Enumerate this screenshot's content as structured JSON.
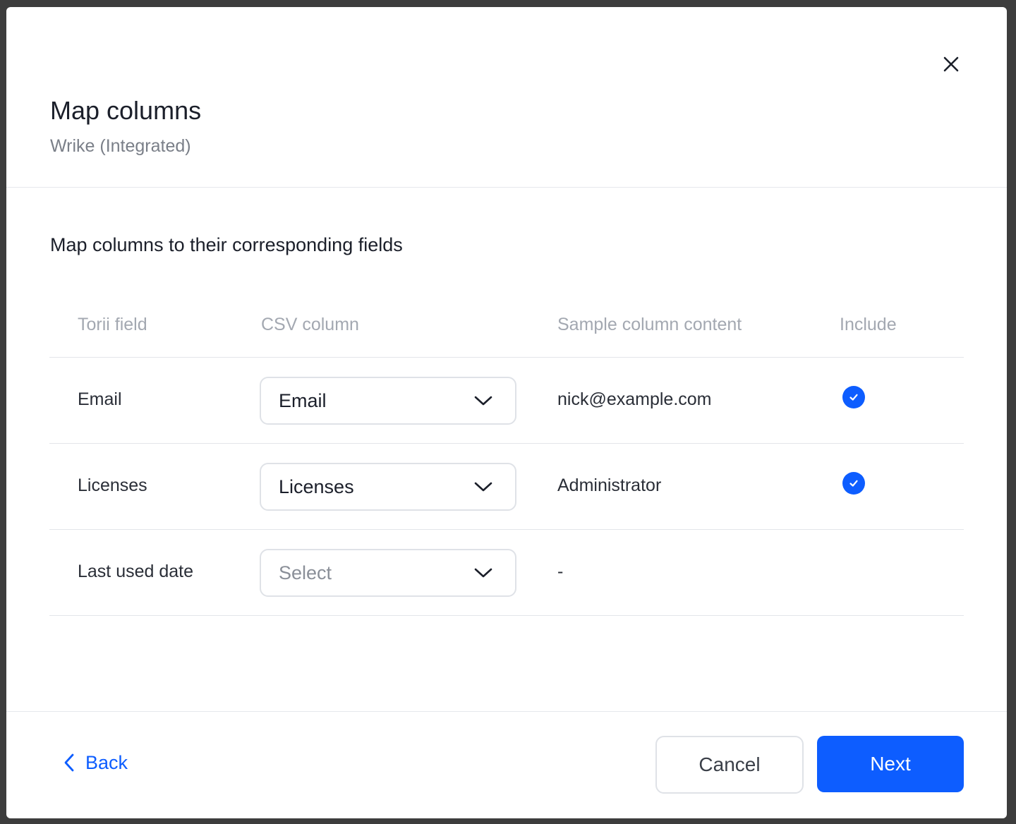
{
  "modal": {
    "title": "Map columns",
    "subtitle": "Wrike (Integrated)",
    "section_title": "Map columns to their corresponding fields"
  },
  "table": {
    "headers": [
      "Torii field",
      "CSV column",
      "Sample column content",
      "Include"
    ],
    "rows": [
      {
        "field": "Email",
        "csv_column": "Email",
        "sample": "nick@example.com",
        "included": true
      },
      {
        "field": "Licenses",
        "csv_column": "Licenses",
        "sample": "Administrator",
        "included": true
      },
      {
        "field": "Last used date",
        "csv_column": "Select",
        "sample": "-",
        "included": false
      }
    ]
  },
  "footer": {
    "back_label": "Back",
    "cancel_label": "Cancel",
    "next_label": "Next"
  },
  "colors": {
    "accent": "#0d5dff",
    "text": "#1b1f2a",
    "muted": "#a3a8b1"
  },
  "icons": {
    "close": "close-icon",
    "chevron": "chevron-down-icon",
    "check": "check-circle-icon",
    "back": "chevron-left-icon"
  }
}
